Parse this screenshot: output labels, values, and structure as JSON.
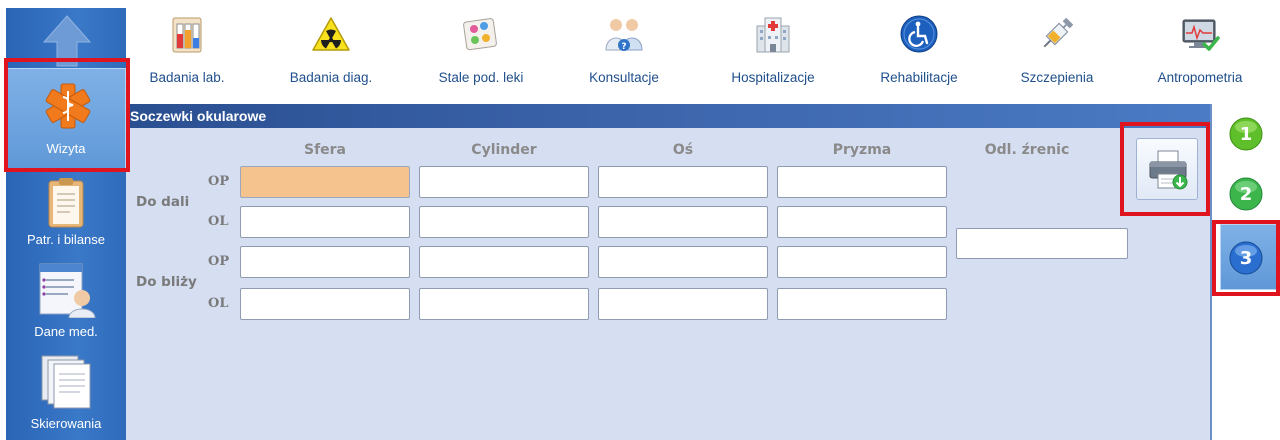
{
  "sidebar": {
    "items": [
      {
        "label": "Wizyta",
        "icon": "medical-star-icon"
      },
      {
        "label": "Patr. i bilanse",
        "icon": "clipboard-icon"
      },
      {
        "label": "Dane med.",
        "icon": "medical-record-icon"
      },
      {
        "label": "Skierowania",
        "icon": "documents-stack-icon"
      }
    ]
  },
  "toolbar": {
    "items": [
      {
        "label": "Badania lab.",
        "icon": "lab-tubes-icon"
      },
      {
        "label": "Badania diag.",
        "icon": "radiation-icon"
      },
      {
        "label": "Stale pod. leki",
        "icon": "pills-icon"
      },
      {
        "label": "Konsultacje",
        "icon": "consultation-icon"
      },
      {
        "label": "Hospitalizacje",
        "icon": "hospital-icon"
      },
      {
        "label": "Rehabilitacje",
        "icon": "wheelchair-icon"
      },
      {
        "label": "Szczepienia",
        "icon": "syringe-icon"
      },
      {
        "label": "Antropometria",
        "icon": "monitor-check-icon"
      }
    ]
  },
  "panel": {
    "title": "Soczewki okularowe",
    "columns": [
      "Sfera",
      "Cylinder",
      "Oś",
      "Pryzma",
      "Odl. źrenic"
    ],
    "groups": [
      {
        "label": "Do dali",
        "rows": [
          "OP",
          "OL"
        ]
      },
      {
        "label": "Do bliży",
        "rows": [
          "OP",
          "OL"
        ]
      }
    ],
    "values": {
      "dali_op": [
        "",
        "",
        "",
        ""
      ],
      "dali_ol": [
        "",
        "",
        "",
        ""
      ],
      "blizy_op": [
        "",
        "",
        "",
        ""
      ],
      "blizy_ol": [
        "",
        "",
        "",
        ""
      ],
      "odl_zrenic": ""
    }
  },
  "steps": [
    "1",
    "2",
    "3"
  ],
  "colors": {
    "sidebar": "#3a78c8",
    "panel_bg": "#d6def2",
    "active_field": "#f5c38e",
    "highlight": "#e0141f"
  }
}
